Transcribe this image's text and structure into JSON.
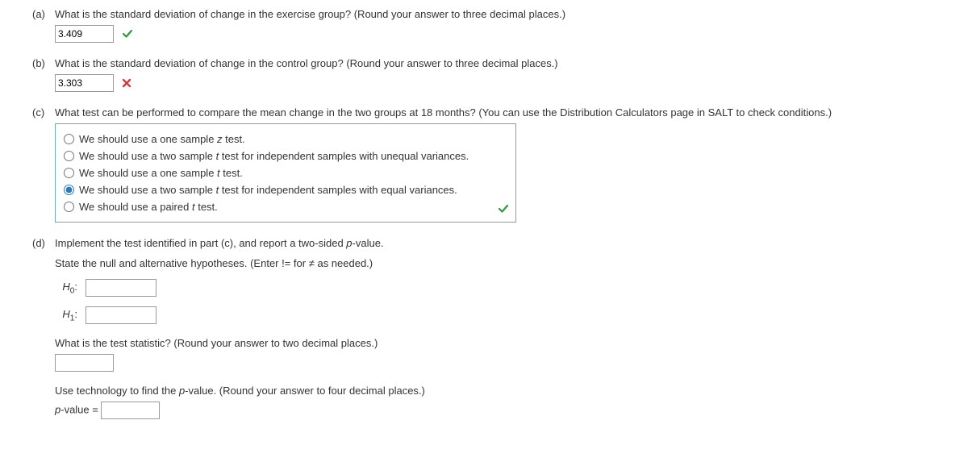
{
  "a": {
    "label": "(a)",
    "question": "What is the standard deviation of change in the exercise group? (Round your answer to three decimal places.)",
    "value": "3.409"
  },
  "b": {
    "label": "(b)",
    "question": "What is the standard deviation of change in the control group? (Round your answer to three decimal places.)",
    "value": "3.303"
  },
  "c": {
    "label": "(c)",
    "question": "What test can be performed to compare the mean change in the two groups at 18 months? (You can use the Distribution Calculators page in SALT to check conditions.)",
    "options": {
      "o1a": "We should use a one sample ",
      "o1b": "z",
      "o1c": " test.",
      "o2a": "We should use a two sample ",
      "o2b": "t",
      "o2c": " test for independent samples with unequal variances.",
      "o3a": "We should use a one sample ",
      "o3b": "t",
      "o3c": " test.",
      "o4a": "We should use a two sample ",
      "o4b": "t",
      "o4c": " test for independent samples with equal variances.",
      "o5a": "We should use a paired ",
      "o5b": "t",
      "o5c": " test."
    }
  },
  "d": {
    "label": "(d)",
    "line1a": "Implement the test identified in part (c), and report a two-sided ",
    "line1b": "p",
    "line1c": "-value.",
    "line2": "State the null and alternative hypotheses. (Enter != for ≠ as needed.)",
    "h0a": "H",
    "h0b": "0",
    "h0c": ":",
    "h1a": "H",
    "h1b": "1",
    "h1c": ":",
    "stat_q": "What is the test statistic? (Round your answer to two decimal places.)",
    "pval_qa": "Use technology to find the ",
    "pval_qb": "p",
    "pval_qc": "-value. (Round your answer to four decimal places.)",
    "pval_label_a": "p",
    "pval_label_b": "-value = "
  }
}
